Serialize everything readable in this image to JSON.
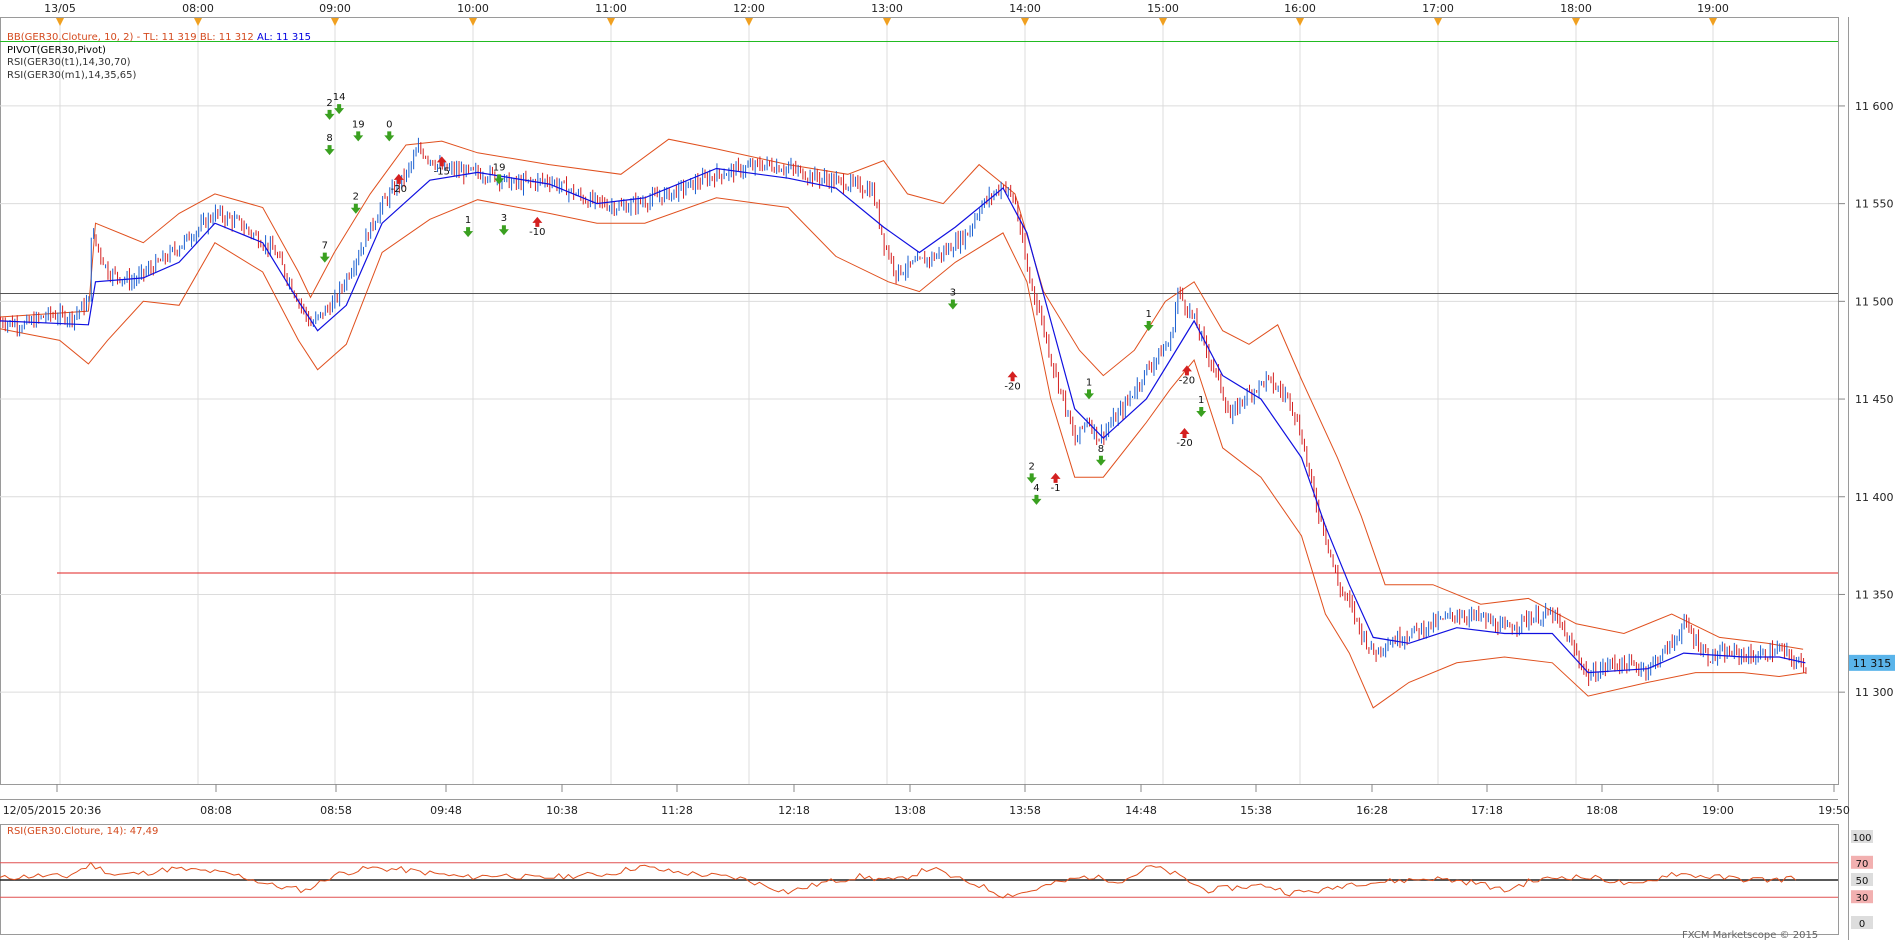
{
  "legend": {
    "bb_name": "BB(GER30.Cloture, 10, 2) -",
    "tl": "TL: 11 319",
    "bl": "BL: 11 312",
    "al": "AL: 11 315",
    "pivot": "PIVOT(GER30,Pivot)",
    "rsi_t1": "RSI(GER30(t1),14,30,70)",
    "rsi_m1": "RSI(GER30(m1),14,35,65)"
  },
  "rsi_panel": {
    "label": "RSI(GER30.Cloture, 14): 47,49",
    "levels": [
      "100",
      "70",
      "50",
      "30",
      "0"
    ]
  },
  "price_badge": "11 315",
  "copyright": "FXCM Marketscope © 2015",
  "colors": {
    "candle_up": "#1a5fd0",
    "candle_down": "#d42020",
    "bollinger": "#e0501e",
    "average": "#1010e0",
    "pivot_line": "#555555",
    "support_line": "#e02020",
    "resistance_line": "#22bb22",
    "rsi_line": "#e0501e",
    "grid": "#dcdcdc",
    "badge": "#5ab4ea"
  },
  "chart_data": {
    "type": "line",
    "top_axis_labels": [
      "13/05",
      "08:00",
      "09:00",
      "10:00",
      "11:00",
      "12:00",
      "13:00",
      "14:00",
      "15:00",
      "16:00",
      "17:00",
      "18:00",
      "19:00"
    ],
    "bottom_axis_labels": [
      "12/05/2015 20:36",
      "08:08",
      "08:58",
      "09:48",
      "10:38",
      "11:28",
      "12:18",
      "13:08",
      "13:58",
      "14:48",
      "15:38",
      "16:28",
      "17:18",
      "18:08",
      "19:00",
      "19:50"
    ],
    "y_ticks": [
      "11 600",
      "11 550",
      "11 500",
      "11 450",
      "11 400",
      "11 350",
      "11 300"
    ],
    "ylim": [
      11253,
      11645
    ],
    "levels": {
      "pivot": 11504,
      "support": 11361,
      "resistance": 11633
    },
    "price_path": [
      [
        0,
        11490
      ],
      [
        10,
        11488
      ],
      [
        20,
        11493
      ],
      [
        30,
        11492
      ],
      [
        37,
        11500
      ],
      [
        38,
        11535
      ],
      [
        45,
        11515
      ],
      [
        55,
        11510
      ],
      [
        70,
        11523
      ],
      [
        90,
        11545
      ],
      [
        100,
        11540
      ],
      [
        115,
        11525
      ],
      [
        125,
        11500
      ],
      [
        130,
        11488
      ],
      [
        140,
        11500
      ],
      [
        150,
        11525
      ],
      [
        160,
        11550
      ],
      [
        170,
        11565
      ],
      [
        175,
        11578
      ],
      [
        185,
        11568
      ],
      [
        195,
        11566
      ],
      [
        205,
        11565
      ],
      [
        215,
        11560
      ],
      [
        230,
        11562
      ],
      [
        245,
        11552
      ],
      [
        260,
        11548
      ],
      [
        280,
        11555
      ],
      [
        300,
        11565
      ],
      [
        320,
        11570
      ],
      [
        330,
        11568
      ],
      [
        340,
        11564
      ],
      [
        355,
        11560
      ],
      [
        365,
        11557
      ],
      [
        370,
        11530
      ],
      [
        375,
        11515
      ],
      [
        385,
        11520
      ],
      [
        395,
        11525
      ],
      [
        405,
        11535
      ],
      [
        410,
        11548
      ],
      [
        420,
        11560
      ],
      [
        425,
        11550
      ],
      [
        430,
        11515
      ],
      [
        435,
        11495
      ],
      [
        440,
        11470
      ],
      [
        445,
        11450
      ],
      [
        450,
        11428
      ],
      [
        455,
        11440
      ],
      [
        460,
        11430
      ],
      [
        470,
        11445
      ],
      [
        480,
        11465
      ],
      [
        490,
        11480
      ],
      [
        493,
        11505
      ],
      [
        500,
        11490
      ],
      [
        510,
        11460
      ],
      [
        515,
        11440
      ],
      [
        520,
        11450
      ],
      [
        530,
        11460
      ],
      [
        540,
        11450
      ],
      [
        545,
        11430
      ],
      [
        550,
        11400
      ],
      [
        555,
        11380
      ],
      [
        560,
        11355
      ],
      [
        565,
        11345
      ],
      [
        570,
        11330
      ],
      [
        575,
        11320
      ],
      [
        580,
        11325
      ],
      [
        590,
        11330
      ],
      [
        600,
        11335
      ],
      [
        610,
        11340
      ],
      [
        620,
        11338
      ],
      [
        630,
        11332
      ],
      [
        640,
        11338
      ],
      [
        650,
        11340
      ],
      [
        655,
        11330
      ],
      [
        665,
        11308
      ],
      [
        675,
        11315
      ],
      [
        690,
        11312
      ],
      [
        700,
        11325
      ],
      [
        705,
        11335
      ],
      [
        715,
        11318
      ],
      [
        725,
        11320
      ],
      [
        735,
        11318
      ],
      [
        745,
        11322
      ],
      [
        752,
        11315
      ],
      [
        756,
        11314
      ]
    ],
    "bollinger_upper": [
      [
        0,
        11492
      ],
      [
        37,
        11495
      ],
      [
        40,
        11540
      ],
      [
        60,
        11530
      ],
      [
        75,
        11545
      ],
      [
        90,
        11555
      ],
      [
        110,
        11548
      ],
      [
        125,
        11515
      ],
      [
        130,
        11502
      ],
      [
        140,
        11525
      ],
      [
        155,
        11555
      ],
      [
        170,
        11580
      ],
      [
        185,
        11582
      ],
      [
        200,
        11576
      ],
      [
        230,
        11570
      ],
      [
        260,
        11565
      ],
      [
        280,
        11583
      ],
      [
        300,
        11578
      ],
      [
        330,
        11570
      ],
      [
        355,
        11565
      ],
      [
        370,
        11572
      ],
      [
        380,
        11555
      ],
      [
        395,
        11550
      ],
      [
        410,
        11570
      ],
      [
        425,
        11555
      ],
      [
        437,
        11505
      ],
      [
        452,
        11475
      ],
      [
        462,
        11462
      ],
      [
        475,
        11475
      ],
      [
        488,
        11500
      ],
      [
        500,
        11510
      ],
      [
        512,
        11485
      ],
      [
        523,
        11478
      ],
      [
        535,
        11488
      ],
      [
        545,
        11460
      ],
      [
        560,
        11420
      ],
      [
        570,
        11390
      ],
      [
        580,
        11355
      ],
      [
        600,
        11355
      ],
      [
        620,
        11345
      ],
      [
        640,
        11348
      ],
      [
        660,
        11335
      ],
      [
        680,
        11330
      ],
      [
        700,
        11340
      ],
      [
        720,
        11328
      ],
      [
        740,
        11325
      ],
      [
        755,
        11322
      ]
    ],
    "bollinger_lower": [
      [
        0,
        11486
      ],
      [
        25,
        11480
      ],
      [
        37,
        11468
      ],
      [
        45,
        11480
      ],
      [
        60,
        11500
      ],
      [
        75,
        11498
      ],
      [
        90,
        11530
      ],
      [
        110,
        11515
      ],
      [
        125,
        11480
      ],
      [
        133,
        11465
      ],
      [
        145,
        11478
      ],
      [
        160,
        11525
      ],
      [
        180,
        11542
      ],
      [
        200,
        11552
      ],
      [
        230,
        11545
      ],
      [
        250,
        11540
      ],
      [
        270,
        11540
      ],
      [
        300,
        11553
      ],
      [
        330,
        11548
      ],
      [
        350,
        11523
      ],
      [
        372,
        11510
      ],
      [
        385,
        11505
      ],
      [
        400,
        11520
      ],
      [
        420,
        11535
      ],
      [
        430,
        11510
      ],
      [
        440,
        11450
      ],
      [
        450,
        11410
      ],
      [
        462,
        11410
      ],
      [
        480,
        11438
      ],
      [
        490,
        11455
      ],
      [
        500,
        11470
      ],
      [
        512,
        11425
      ],
      [
        528,
        11410
      ],
      [
        545,
        11380
      ],
      [
        555,
        11340
      ],
      [
        565,
        11320
      ],
      [
        575,
        11292
      ],
      [
        590,
        11305
      ],
      [
        610,
        11315
      ],
      [
        630,
        11318
      ],
      [
        650,
        11315
      ],
      [
        665,
        11298
      ],
      [
        690,
        11305
      ],
      [
        710,
        11310
      ],
      [
        730,
        11310
      ],
      [
        745,
        11308
      ],
      [
        756,
        11310
      ]
    ],
    "average_line": [
      [
        0,
        11490
      ],
      [
        37,
        11488
      ],
      [
        40,
        11510
      ],
      [
        60,
        11512
      ],
      [
        75,
        11520
      ],
      [
        90,
        11540
      ],
      [
        110,
        11530
      ],
      [
        125,
        11500
      ],
      [
        133,
        11485
      ],
      [
        145,
        11498
      ],
      [
        160,
        11540
      ],
      [
        180,
        11562
      ],
      [
        200,
        11566
      ],
      [
        230,
        11560
      ],
      [
        250,
        11550
      ],
      [
        270,
        11553
      ],
      [
        300,
        11568
      ],
      [
        330,
        11563
      ],
      [
        350,
        11558
      ],
      [
        370,
        11538
      ],
      [
        385,
        11525
      ],
      [
        400,
        11538
      ],
      [
        420,
        11558
      ],
      [
        430,
        11535
      ],
      [
        440,
        11490
      ],
      [
        450,
        11445
      ],
      [
        462,
        11430
      ],
      [
        480,
        11450
      ],
      [
        490,
        11470
      ],
      [
        500,
        11490
      ],
      [
        512,
        11462
      ],
      [
        528,
        11450
      ],
      [
        545,
        11420
      ],
      [
        555,
        11385
      ],
      [
        565,
        11355
      ],
      [
        575,
        11328
      ],
      [
        590,
        11325
      ],
      [
        610,
        11333
      ],
      [
        630,
        11330
      ],
      [
        650,
        11330
      ],
      [
        665,
        11310
      ],
      [
        690,
        11312
      ],
      [
        705,
        11320
      ],
      [
        730,
        11318
      ],
      [
        745,
        11318
      ],
      [
        756,
        11315
      ]
    ],
    "signal_labels": [
      {
        "text": "14",
        "x": 142,
        "y": 11603
      },
      {
        "text": "2",
        "x": 138,
        "y": 11600
      },
      {
        "text": "19",
        "x": 150,
        "y": 11589
      },
      {
        "text": "0",
        "x": 163,
        "y": 11589
      },
      {
        "text": "8",
        "x": 138,
        "y": 11582
      },
      {
        "text": "-15",
        "x": 185,
        "y": 11565
      },
      {
        "text": "19",
        "x": 209,
        "y": 11567
      },
      {
        "text": "-20",
        "x": 167,
        "y": 11556
      },
      {
        "text": "2",
        "x": 149,
        "y": 11552
      },
      {
        "text": "1",
        "x": 196,
        "y": 11540
      },
      {
        "text": "3",
        "x": 211,
        "y": 11541
      },
      {
        "text": "-10",
        "x": 225,
        "y": 11534
      },
      {
        "text": "7",
        "x": 136,
        "y": 11527
      },
      {
        "text": "3",
        "x": 399,
        "y": 11503
      },
      {
        "text": "1",
        "x": 481,
        "y": 11492
      },
      {
        "text": "-20",
        "x": 497,
        "y": 11458
      },
      {
        "text": "-20",
        "x": 424,
        "y": 11455
      },
      {
        "text": "1",
        "x": 456,
        "y": 11457
      },
      {
        "text": "1",
        "x": 503,
        "y": 11448
      },
      {
        "text": "-20",
        "x": 496,
        "y": 11426
      },
      {
        "text": "8",
        "x": 461,
        "y": 11423
      },
      {
        "text": "2",
        "x": 432,
        "y": 11414
      },
      {
        "text": "4",
        "x": 434,
        "y": 11403
      },
      {
        "text": "-1",
        "x": 442,
        "y": 11403
      }
    ],
    "rsi_series": [
      [
        0,
        52
      ],
      [
        15,
        55
      ],
      [
        28,
        54
      ],
      [
        38,
        68
      ],
      [
        48,
        56
      ],
      [
        60,
        58
      ],
      [
        72,
        63
      ],
      [
        88,
        60
      ],
      [
        100,
        55
      ],
      [
        115,
        43
      ],
      [
        128,
        38
      ],
      [
        140,
        56
      ],
      [
        155,
        64
      ],
      [
        168,
        62
      ],
      [
        180,
        58
      ],
      [
        195,
        53
      ],
      [
        210,
        56
      ],
      [
        225,
        52
      ],
      [
        240,
        55
      ],
      [
        255,
        57
      ],
      [
        268,
        66
      ],
      [
        280,
        60
      ],
      [
        295,
        56
      ],
      [
        310,
        52
      ],
      [
        330,
        36
      ],
      [
        345,
        47
      ],
      [
        360,
        54
      ],
      [
        375,
        49
      ],
      [
        390,
        64
      ],
      [
        400,
        52
      ],
      [
        410,
        44
      ],
      [
        420,
        32
      ],
      [
        430,
        36
      ],
      [
        440,
        45
      ],
      [
        455,
        54
      ],
      [
        470,
        49
      ],
      [
        482,
        66
      ],
      [
        492,
        57
      ],
      [
        505,
        38
      ],
      [
        520,
        42
      ],
      [
        530,
        44
      ],
      [
        540,
        35
      ],
      [
        555,
        38
      ],
      [
        565,
        46
      ],
      [
        580,
        48
      ],
      [
        600,
        52
      ],
      [
        620,
        46
      ],
      [
        630,
        37
      ],
      [
        640,
        48
      ],
      [
        655,
        54
      ],
      [
        670,
        52
      ],
      [
        685,
        43
      ],
      [
        700,
        58
      ],
      [
        715,
        54
      ],
      [
        730,
        51
      ],
      [
        745,
        50
      ],
      [
        750,
        53
      ]
    ],
    "rsi_ylim": [
      0,
      100
    ],
    "rsi_levels": [
      30,
      50,
      70
    ],
    "title": "",
    "xlabel": "",
    "ylabel": ""
  }
}
